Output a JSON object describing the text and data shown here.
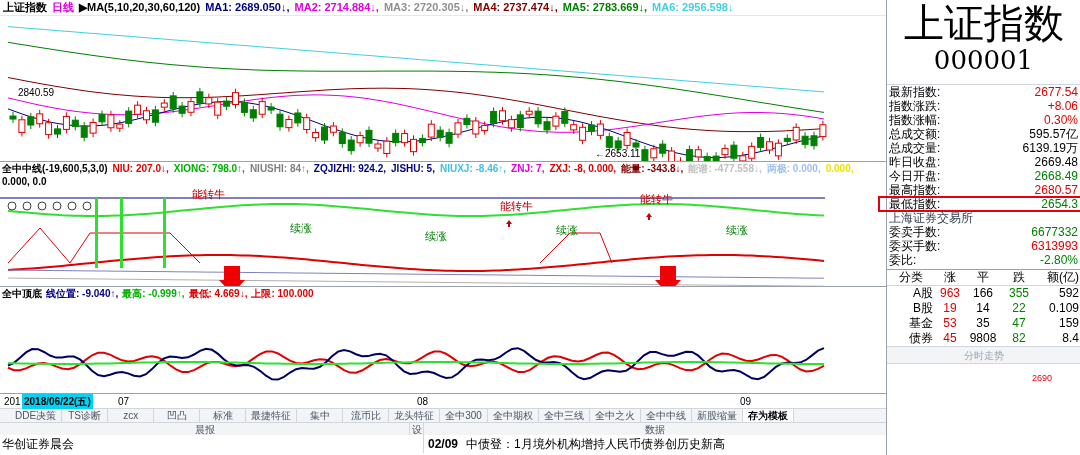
{
  "main_chart": {
    "legend": [
      {
        "text": "上证指数",
        "color": "#000000"
      },
      {
        "text": "日线",
        "color": "#e000e0"
      },
      {
        "text": "▶MA(5,10,20,30,60,120)",
        "color": "#000000"
      },
      {
        "text": "MA1: 2689.050↓,",
        "color": "#000080"
      },
      {
        "text": "MA2: 2714.884↓,",
        "color": "#e000e0"
      },
      {
        "text": "MA3: 2720.305↓,",
        "color": "#909090"
      },
      {
        "text": "MA4: 2737.474↓,",
        "color": "#800000"
      },
      {
        "text": "MA5: 2783.669↓,",
        "color": "#008000"
      },
      {
        "text": "MA6: 2956.598↓",
        "color": "#40d0e0"
      }
    ],
    "high_label": "2840.59",
    "low_label": "←2653.11"
  },
  "indicator_panel": {
    "legend": [
      {
        "text": "全中中线(-19,600,5,3,0)",
        "color": "#000000"
      },
      {
        "text": "NIU: 207.0↓,",
        "color": "#e00000"
      },
      {
        "text": "XIONG: 798.0↑,",
        "color": "#00b000"
      },
      {
        "text": "NIUSHI: 84↑,",
        "color": "#808080"
      },
      {
        "text": "ZQJIZHI: 924.2,",
        "color": "#000080"
      },
      {
        "text": "JISHU: 5,",
        "color": "#000080"
      },
      {
        "text": "NIUXJ: -8.46↑,",
        "color": "#40c0e0"
      },
      {
        "text": "ZNJ: 7,",
        "color": "#e000e0"
      },
      {
        "text": "ZXJ: -8, 0.000,",
        "color": "#e00000"
      },
      {
        "text": "能量: -343.8↓,",
        "color": "#800000"
      },
      {
        "text": "能谱: -477.558↓,",
        "color": "#c0c0c0"
      },
      {
        "text": "两极: 0.000,",
        "color": "#a0c0f0"
      },
      {
        "text": "0.000,",
        "color": "#f0e000"
      },
      {
        "text": "0.000, 0.0",
        "color": "#000000"
      }
    ],
    "signals": [
      {
        "text": "能转牛",
        "kind": "bull"
      },
      {
        "text": "能转牛",
        "kind": "bull"
      },
      {
        "text": "能转牛",
        "kind": "bull"
      }
    ],
    "trend_labels": [
      "续涨",
      "续涨",
      "续涨",
      "续涨"
    ]
  },
  "lower_panel": {
    "legend": [
      {
        "text": "全中顶底",
        "color": "#000000"
      },
      {
        "text": "线位置: -9.040↑,",
        "color": "#000080"
      },
      {
        "text": "最高: -0.999↑,",
        "color": "#00b000"
      },
      {
        "text": "最低: 4.669↓,",
        "color": "#e00000"
      },
      {
        "text": "上限: 100.000",
        "color": "#e00000"
      }
    ]
  },
  "date_axis": {
    "labels": [
      "201",
      "07",
      "08",
      "09"
    ],
    "cursor_date": "2018/06/22(五)"
  },
  "tabs": [
    {
      "label": "DDE决策",
      "selected": false
    },
    {
      "label": "TS诊断",
      "selected": false
    },
    {
      "label": "zcx",
      "selected": false
    },
    {
      "label": "凹凸",
      "selected": false
    },
    {
      "label": "标准",
      "selected": false
    },
    {
      "label": "最捷特征",
      "selected": false
    },
    {
      "label": "集中",
      "selected": false
    },
    {
      "label": "流币比",
      "selected": false
    },
    {
      "label": "龙头特征",
      "selected": false
    },
    {
      "label": "全中300",
      "selected": false
    },
    {
      "label": "全中期权",
      "selected": false
    },
    {
      "label": "全中三线",
      "selected": false
    },
    {
      "label": "全中之火",
      "selected": false
    },
    {
      "label": "全中中线",
      "selected": false
    },
    {
      "label": "新股缩量",
      "selected": false
    },
    {
      "label": "存为模板",
      "selected": true
    }
  ],
  "news": {
    "left_header": "晨报",
    "setting_label": "设",
    "right_header": "数据",
    "left_item": "华创证券晨会",
    "right_item": {
      "date": "02/09",
      "title": "中债登：1月境外机构增持人民币债券创历史新高"
    }
  },
  "quote_panel": {
    "name": "上证指数",
    "code": "000001",
    "rows": [
      {
        "label": "最新指数:",
        "value": "2677.54",
        "color": "#e00000",
        "highlighted": false
      },
      {
        "label": "指数涨跌:",
        "value": "+8.06",
        "color": "#e00000",
        "highlighted": false
      },
      {
        "label": "指数涨幅:",
        "value": "0.30%",
        "color": "#e00000",
        "highlighted": false
      },
      {
        "label": "总成交额:",
        "value": "595.57亿",
        "color": "#000000",
        "highlighted": false
      },
      {
        "label": "总成交量:",
        "value": "6139.19万",
        "color": "#000000",
        "highlighted": false
      },
      {
        "label": "昨日收盘:",
        "value": "2669.48",
        "color": "#000000",
        "highlighted": false
      },
      {
        "label": "今日开盘:",
        "value": "2668.49",
        "color": "#008000",
        "highlighted": false
      },
      {
        "label": "最高指数:",
        "value": "2680.57",
        "color": "#e00000",
        "highlighted": false
      },
      {
        "label": "最低指数:",
        "value": "2654.3",
        "color": "#008000",
        "highlighted": true
      }
    ],
    "exchange": "上海证券交易所",
    "order_rows": [
      {
        "label": "委卖手数:",
        "value": "6677332",
        "color": "#008000"
      },
      {
        "label": "委买手数:",
        "value": "6313993",
        "color": "#e00000"
      },
      {
        "label": "委比:",
        "value": "-2.80%",
        "color": "#008000"
      }
    ],
    "breadth": {
      "columns": [
        "分类",
        "涨",
        "平",
        "跌",
        "额(亿)"
      ],
      "rows": [
        [
          "A股",
          "963",
          "166",
          "355",
          "592"
        ],
        [
          "B股",
          "19",
          "14",
          "22",
          "0.109"
        ],
        [
          "基金",
          "53",
          "35",
          "47",
          "159"
        ],
        [
          "债券",
          "45",
          "9808",
          "82",
          "8.4"
        ]
      ]
    },
    "intraday_button": "分时走势",
    "intraday_tick": "2690"
  }
}
